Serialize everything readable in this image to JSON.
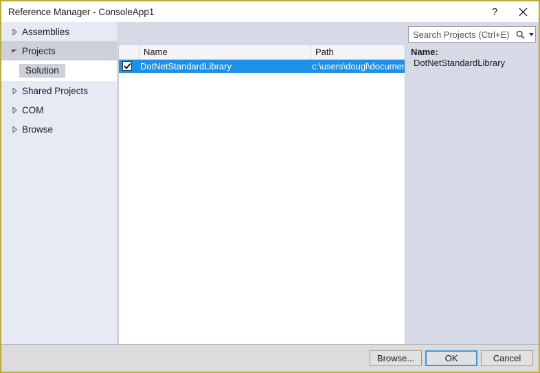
{
  "window": {
    "title": "Reference Manager - ConsoleApp1",
    "help_icon": "question-mark-icon",
    "close_icon": "close-icon",
    "border_color": "#bfa93a"
  },
  "sidebar": {
    "items": [
      {
        "label": "Assemblies",
        "state": "collapsed",
        "selected": false
      },
      {
        "label": "Projects",
        "state": "expanded",
        "selected": true
      },
      {
        "label": "Shared Projects",
        "state": "collapsed",
        "selected": false
      },
      {
        "label": "COM",
        "state": "collapsed",
        "selected": false
      },
      {
        "label": "Browse",
        "state": "collapsed",
        "selected": false
      }
    ],
    "sub_item": {
      "label": "Solution",
      "selected": true
    }
  },
  "search": {
    "placeholder": "Search Projects (Ctrl+E)",
    "value": "",
    "icon": "search-icon",
    "dropdown_icon": "chevron-down-icon"
  },
  "list": {
    "columns": [
      "",
      "Name",
      "Path"
    ],
    "rows": [
      {
        "checked": true,
        "name": "DotNetStandardLibrary",
        "path": "c:\\users\\dougl\\documen",
        "selected": true
      }
    ],
    "selection_color": "#1e90e8"
  },
  "scrollbar": {
    "left_arrow_icon": "triangle-left-icon",
    "right_arrow_icon": "triangle-right-icon",
    "thumb_position_percent": 0,
    "thumb_size_percent": 65
  },
  "details": {
    "name_label": "Name:",
    "name_value": "DotNetStandardLibrary"
  },
  "buttons": {
    "browse": "Browse...",
    "ok": "OK",
    "cancel": "Cancel",
    "default_button": "OK"
  }
}
